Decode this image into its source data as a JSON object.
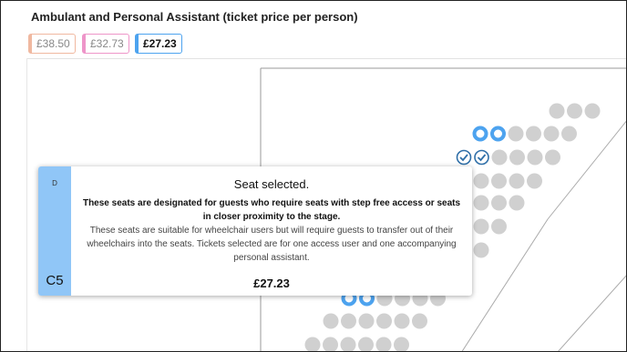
{
  "section_title": "Ambulant and Personal Assistant (ticket price per person)",
  "price_options": [
    {
      "label": "£38.50",
      "color": "#f0b8a0"
    },
    {
      "label": "£32.73",
      "color": "#ee95c9"
    },
    {
      "label": "£27.23",
      "color": "#4da3ef",
      "selected": true
    }
  ],
  "colors": {
    "seat_available": "#d0d0d0",
    "seat_selectable": "#4da3ef",
    "tooltip_band": "#90c6f7"
  },
  "tooltip": {
    "row": "D",
    "seat": "C5",
    "heading": "Seat selected.",
    "bold_text": "These seats are designated for guests who require seats with step free access or seats in closer proximity to the stage.",
    "body_text": "These seats are suitable for wheelchair users but will require guests to transfer out of their wheelchairs into the seats. Tickets selected are for one access user and one accompanying personal assistant.",
    "price": "£27.23"
  }
}
